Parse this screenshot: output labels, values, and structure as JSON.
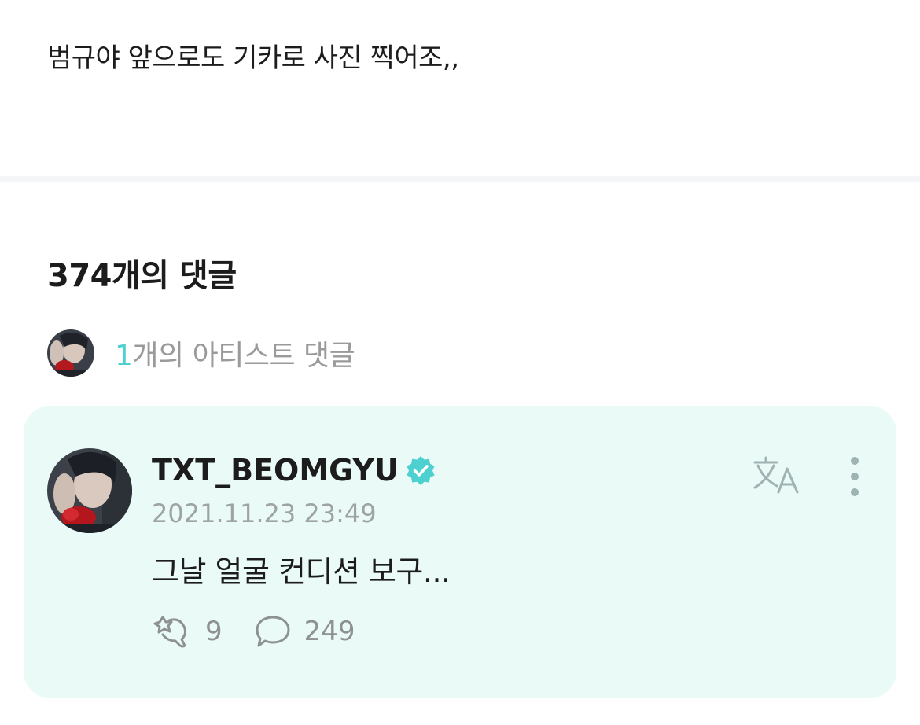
{
  "post": {
    "text": "범규야 앞으로도 기카로 사진 찍어조,,"
  },
  "comments_header": {
    "count_label": "374개의 댓글"
  },
  "artist_comments": {
    "count": "1",
    "label": "개의 아티스트 댓글"
  },
  "comment": {
    "author": "TXT_BEOMGYU",
    "verified": true,
    "timestamp": "2021.11.23 23:49",
    "body": "그날 얼굴 컨디션 보구...",
    "like_count": "9",
    "reply_count": "249",
    "icons": {
      "translate": "translate-icon",
      "more": "more-vertical-icon",
      "like": "cheer-icon",
      "reply": "speech-bubble-icon",
      "verified": "verified-badge-icon"
    }
  },
  "colors": {
    "accent": "#4fd0d0",
    "card_bg": "#eafaf7",
    "verified": "#4fd0d0",
    "muted": "#9ea3a5"
  }
}
